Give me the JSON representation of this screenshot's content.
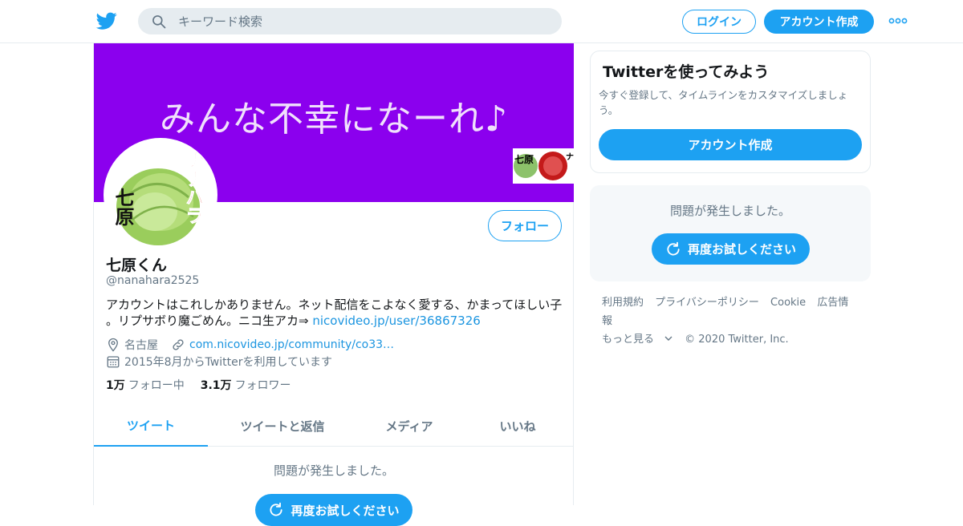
{
  "header": {
    "search_placeholder": "キーワード検索",
    "login_label": "ログイン",
    "signup_label": "アカウント作成"
  },
  "colors": {
    "brand": "#1da1f2",
    "banner": "#8b00ee",
    "muted": "#657786"
  },
  "profile": {
    "banner_text": "みんな不幸になーれ♪",
    "avatar_text_left": "七原",
    "avatar_text_right": "ナナハラ",
    "banner_thumb_left": "七原",
    "banner_thumb_right": "ナナハラ",
    "follow_label": "フォロー",
    "name": "七原くん",
    "handle": "@nanahara2525",
    "bio_text": "アカウントはこれしかありません。ネット配信をこよなく愛する、かまってほしい子 。リプサボり魔ごめん。ニコ生アカ⇒ ",
    "bio_link": "nicovideo.jp/user/36867326",
    "location": "名古屋",
    "website": "com.nicovideo.jp/community/co33…",
    "joined": "2015年8月からTwitterを利用しています",
    "following_count": "1万",
    "following_label": "フォロー中",
    "followers_count": "3.1万",
    "followers_label": "フォロワー"
  },
  "tabs": [
    {
      "label": "ツイート"
    },
    {
      "label": "ツイートと返信"
    },
    {
      "label": "メディア"
    },
    {
      "label": "いいね"
    }
  ],
  "main": {
    "error_text": "問題が発生しました。",
    "retry_label": "再度お試しください"
  },
  "sidebar": {
    "card_title": "Twitterを使ってみよう",
    "card_subtitle": "今すぐ登録して、タイムラインをカスタマイズしましょう。",
    "card_button": "アカウント作成",
    "error_text": "問題が発生しました。",
    "retry_label": "再度お試しください"
  },
  "footer": {
    "links": [
      "利用規約",
      "プライバシーポリシー",
      "Cookie",
      "広告情報"
    ],
    "more_label": "もっと見る",
    "copyright": "© 2020 Twitter, Inc."
  }
}
